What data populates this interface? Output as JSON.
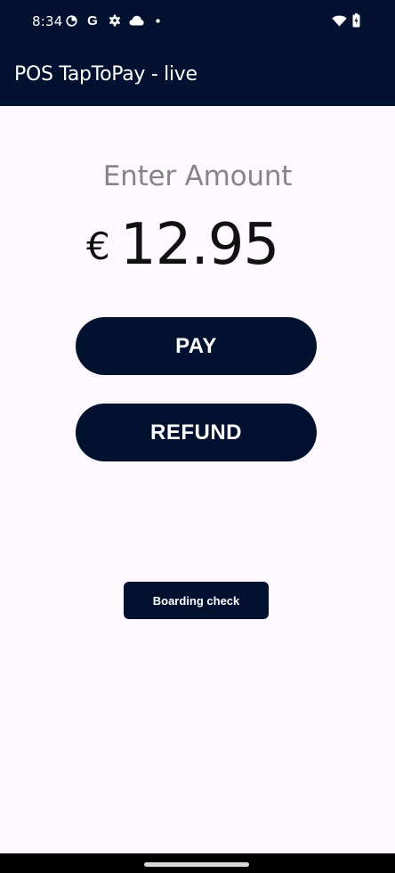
{
  "status_bar": {
    "time": "8:34",
    "icons": [
      "timer-icon",
      "google-g-icon",
      "settings-gear-icon",
      "cloud-icon",
      "dot-icon",
      "wifi-icon",
      "battery-icon"
    ],
    "google_letter": "G"
  },
  "app_bar": {
    "title": "POS TapToPay - live"
  },
  "main": {
    "prompt": "Enter Amount",
    "currency_symbol": "€",
    "amount": "12.95",
    "pay_label": "PAY",
    "refund_label": "REFUND",
    "boarding_label": "Boarding check"
  },
  "colors": {
    "primary": "#021130",
    "background": "#fdf8fd",
    "prompt_text": "#858585"
  }
}
